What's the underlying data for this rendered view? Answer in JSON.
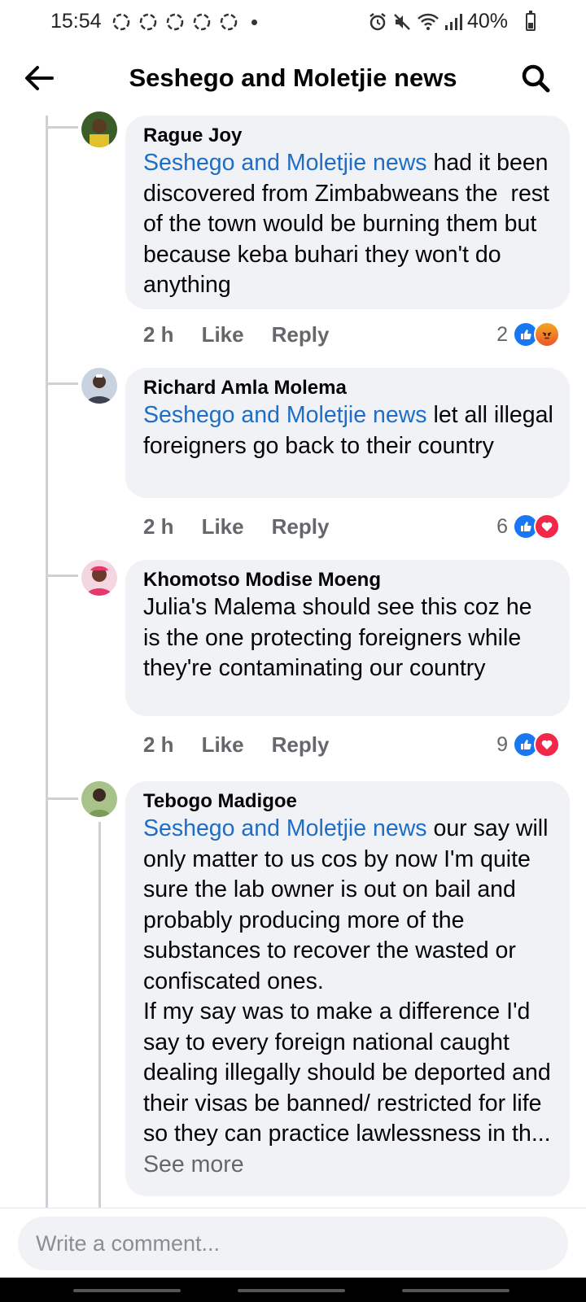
{
  "status_bar": {
    "time": "15:54",
    "battery": "40%",
    "battery_level": 0.4
  },
  "header": {
    "title": "Seshego and Moletjie news",
    "back_icon": "arrow-left-icon",
    "search_icon": "search-icon"
  },
  "comments": [
    {
      "author": "Rague Joy",
      "mention": "Seshego and Moletjie news",
      "text": " had it been discovered from Zimbabweans the  rest of the town would be burning them but because keba buhari they won't do anything",
      "see_more": "",
      "time": "2 h",
      "like_label": "Like",
      "reply_label": "Reply",
      "reaction_count": "2",
      "reactions": [
        "like",
        "angry"
      ],
      "avatar_colors": [
        "#3b5d2a",
        "#e2c12a"
      ]
    },
    {
      "author": "Richard Amla Molema",
      "mention": "Seshego and Moletjie news",
      "text": " let all illegal foreigners go back to their country",
      "see_more": "",
      "time": "2 h",
      "like_label": "Like",
      "reply_label": "Reply",
      "reaction_count": "6",
      "reactions": [
        "like",
        "love"
      ],
      "avatar_colors": [
        "#c9d3e0",
        "#3d4250"
      ]
    },
    {
      "author": "Khomotso Modise Moeng",
      "mention": "",
      "text": "Julia's Malema should see this coz he is the one protecting foreigners while they're contaminating our country",
      "see_more": "",
      "time": "2 h",
      "like_label": "Like",
      "reply_label": "Reply",
      "reaction_count": "9",
      "reactions": [
        "like",
        "love"
      ],
      "avatar_colors": [
        "#e8386b",
        "#6b3a2a"
      ]
    },
    {
      "author": "Tebogo Madigoe",
      "mention": "Seshego and Moletjie news",
      "text": " our say will only matter to us cos by now I'm quite sure the lab owner is out on bail and probably producing more of the substances to recover the wasted or confiscated ones.\nIf my say was to make a difference I'd say to every foreign national caught dealing illegally should be deported and their visas be banned/ restricted for life so they can practice lawlessness in th...",
      "see_more": " See more",
      "time": "",
      "like_label": "",
      "reply_label": "",
      "reaction_count": "",
      "reactions": [],
      "avatar_colors": [
        "#7a9a5a",
        "#3a2a22"
      ]
    }
  ],
  "composer": {
    "placeholder": "Write a comment..."
  }
}
